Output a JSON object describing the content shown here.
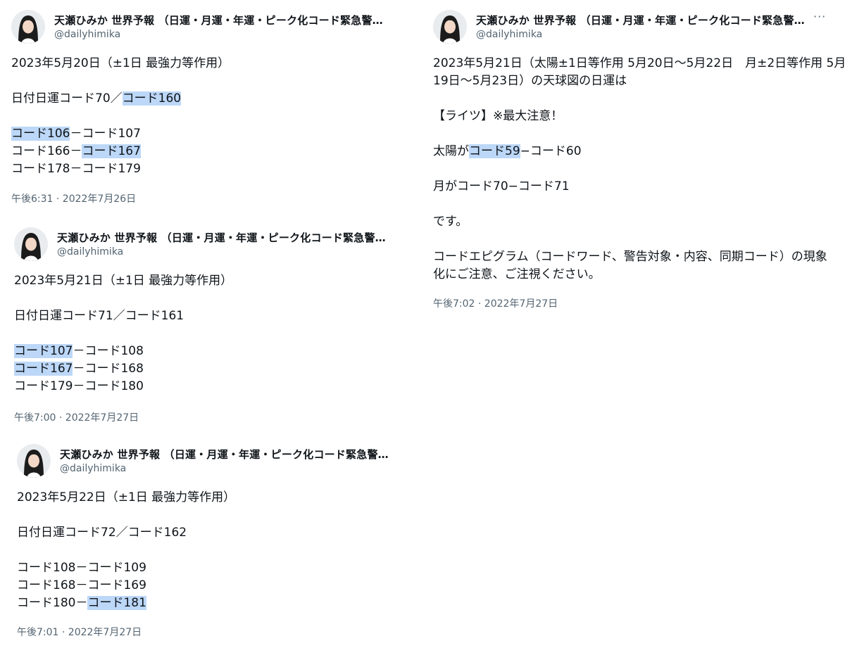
{
  "author": {
    "name": "天瀬ひみか 世界予報 （日運・月運・年運・ピーク化コード緊急警…",
    "handle": "@dailyhimika"
  },
  "tweets": [
    {
      "lines": [
        "2023年5月20日（±1日 最強力等作用）",
        "",
        "日付日運コード70／コード160",
        "",
        "コード106－コード107",
        "コード166－コード167",
        "コード178－コード179"
      ],
      "highlights": [
        "コード160",
        "コード106",
        "コード167"
      ],
      "timestamp": "午後6:31 · 2022年7月26日"
    },
    {
      "lines": [
        "2023年5月21日（±1日 最強力等作用）",
        "",
        "日付日運コード71／コード161",
        "",
        "コード107－コード108",
        "コード167－コード168",
        "コード179－コード180"
      ],
      "highlights": [
        "コード107",
        "コード167"
      ],
      "timestamp": "午後7:00 · 2022年7月27日"
    },
    {
      "lines": [
        "2023年5月22日（±1日 最強力等作用）",
        "",
        "日付日運コード72／コード162",
        "",
        "コード108－コード109",
        "コード168－コード169",
        "コード180－コード181"
      ],
      "highlights": [
        "コード181"
      ],
      "timestamp": "午後7:01 · 2022年7月27日"
    },
    {
      "lines": [
        "2023年5月21日（太陽±1日等作用 5月20日〜5月22日　月±2日等作用 5月",
        "19日〜5月23日）の天球図の日運は",
        "",
        "【ライツ】※最大注意！",
        "",
        "太陽がコード59−コード60",
        "",
        "月がコード70−コード71",
        "",
        "です。",
        "",
        "コードエピグラム（コードワード、警告対象・内容、同期コード）の現象",
        "化にご注意、ご注視ください。"
      ],
      "highlights": [
        "コード59"
      ],
      "timestamp": "午後7:02 · 2022年7月27日"
    }
  ],
  "more_button": "···"
}
